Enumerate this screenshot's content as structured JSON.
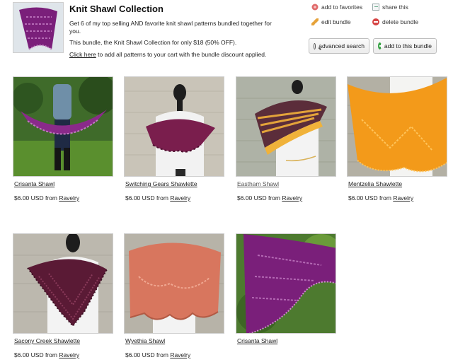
{
  "bundle": {
    "title": "Knit Shawl Collection",
    "description_1": "Get 6 of my top selling AND favorite knit shawl patterns bundled together for you.",
    "description_2": "This bundle, the Knit Shawl Collection for only $18 (50% OFF).",
    "click_link": "Click here",
    "click_rest": " to add all patterns to your cart with the bundle discount applied.",
    "thumb_icon": "purple-lace-shawl-photo"
  },
  "actions": {
    "favorites": "add to favorites",
    "share": "share this",
    "edit": "edit bundle",
    "delete": "delete bundle",
    "advanced_search": "advanced search",
    "add_to_bundle": "add to this bundle"
  },
  "price_from": "$6.00 USD from ",
  "store": "Ravelry",
  "patterns": [
    {
      "name": "Crisanta Shawl",
      "price": "$6.00 USD from ",
      "store": "Ravelry"
    },
    {
      "name": "Switching Gears Shawlette",
      "price": "$6.00 USD from ",
      "store": "Ravelry"
    },
    {
      "name": "Eastham Shawl",
      "price": "$6.00 USD from ",
      "store": "Ravelry"
    },
    {
      "name": "Mentzelia Shawlette",
      "price": "$6.00 USD from ",
      "store": "Ravelry"
    },
    {
      "name": "Sacony Creek Shawlette",
      "price": "$6.00 USD from ",
      "store": "Ravelry"
    },
    {
      "name": "Wyethia Shawl",
      "price": "$6.00 USD from ",
      "store": "Ravelry"
    },
    {
      "name": "Crisanta Shawl"
    }
  ],
  "colors": {
    "purple": "#7a1f7a",
    "plum": "#6b1e46",
    "orange": "#f39a1a",
    "wine": "#5a1a35",
    "salmon": "#d8765e"
  }
}
